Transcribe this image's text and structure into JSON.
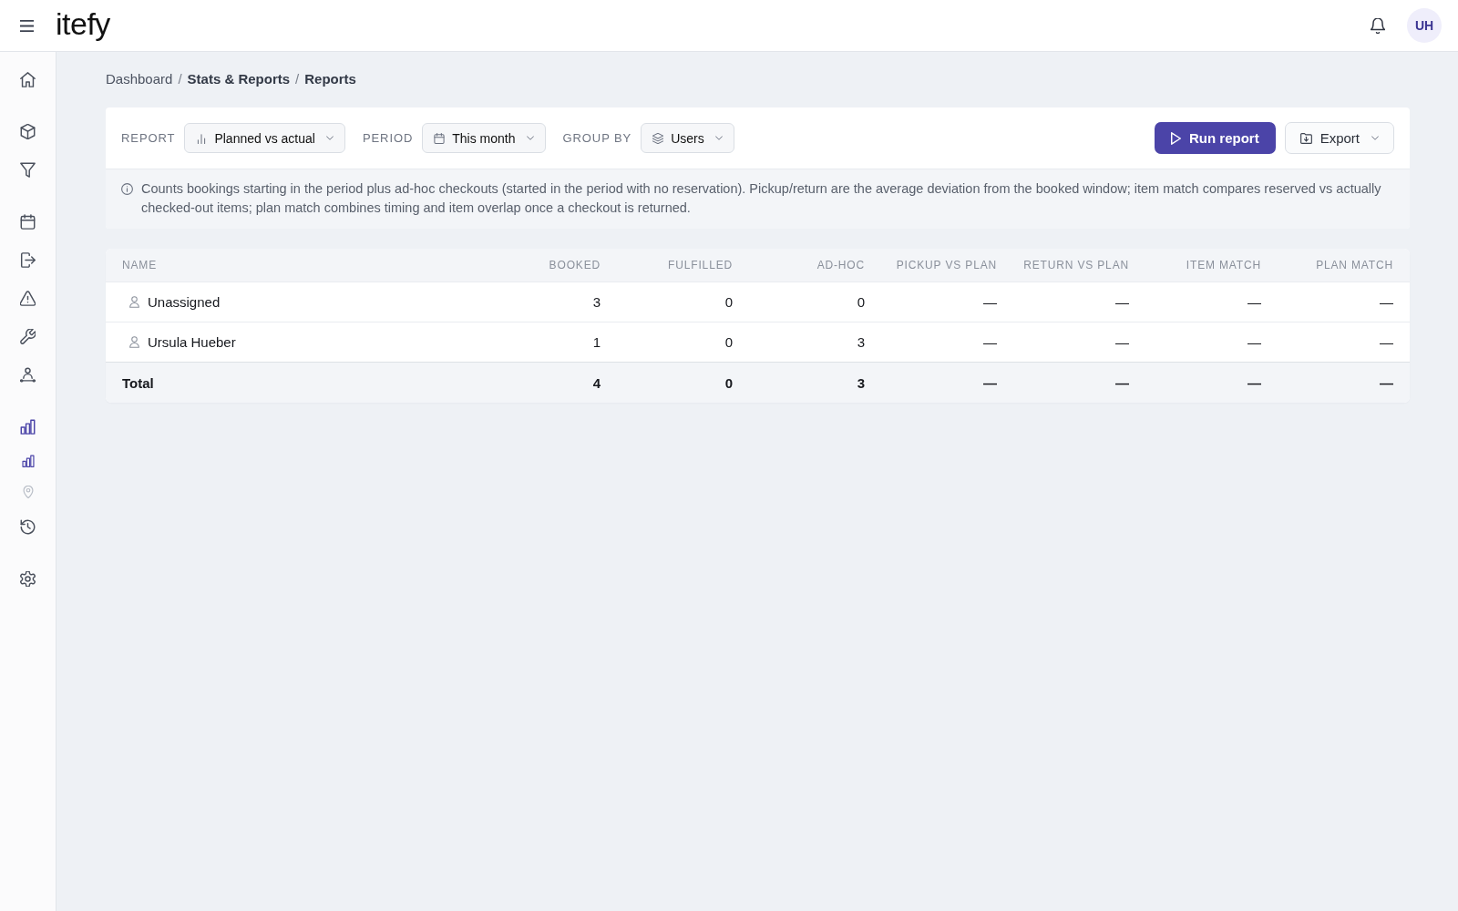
{
  "top_bar": {
    "logo": "itefy",
    "avatar_initials": "UH"
  },
  "sidebar": {
    "groups": [
      {
        "items": [
          {
            "kind": "main",
            "selected": false,
            "disabled": false
          }
        ]
      },
      {
        "items": [
          {
            "kind": "main",
            "selected": false,
            "disabled": false
          },
          {
            "kind": "main",
            "selected": false,
            "disabled": false
          }
        ]
      },
      {
        "items": [
          {
            "kind": "main",
            "selected": false,
            "disabled": false
          },
          {
            "kind": "main",
            "selected": false,
            "disabled": false
          },
          {
            "kind": "main",
            "selected": false,
            "disabled": false
          },
          {
            "kind": "main",
            "selected": false,
            "disabled": false
          },
          {
            "kind": "main",
            "selected": false,
            "disabled": false
          }
        ]
      },
      {
        "items": [
          {
            "kind": "main",
            "selected": true,
            "disabled": false
          },
          {
            "kind": "sub",
            "selected": true,
            "disabled": false
          },
          {
            "kind": "sub",
            "selected": false,
            "disabled": true
          },
          {
            "kind": "main",
            "selected": false,
            "disabled": false
          }
        ]
      },
      {
        "items": [
          {
            "kind": "main",
            "selected": false,
            "disabled": false
          }
        ]
      }
    ]
  },
  "breadcrumb": [
    {
      "kind": "link",
      "text": "Dashboard"
    },
    {
      "kind": "separator",
      "text": "/"
    },
    {
      "kind": "section",
      "text": "Stats & Reports"
    },
    {
      "kind": "separator",
      "text": "/"
    },
    {
      "kind": "current",
      "text": "Reports"
    }
  ],
  "toolbar": {
    "filters": [
      {
        "label": "REPORT",
        "value": "Planned vs actual"
      },
      {
        "label": "PERIOD",
        "value": "This month"
      },
      {
        "label": "GROUP BY",
        "value": "Users"
      }
    ],
    "run_button": "Run report",
    "export_button": "Export"
  },
  "info": "Counts bookings starting in the period plus ad-hoc checkouts (started in the period with no reservation). Pickup/return are the average deviation from the booked window; item match compares reserved vs actually checked-out items; plan match combines timing and item overlap once a checkout is returned.",
  "table": {
    "columns": [
      "NAME",
      "BOOKED",
      "FULFILLED",
      "AD-HOC",
      "PICKUP VS PLAN",
      "RETURN VS PLAN",
      "ITEM MATCH",
      "PLAN MATCH"
    ],
    "rows": [
      {
        "cells": [
          "Unassigned",
          "3",
          "0",
          "0",
          "—",
          "—",
          "—",
          "—"
        ]
      },
      {
        "cells": [
          "Ursula Hueber",
          "1",
          "0",
          "3",
          "—",
          "—",
          "—",
          "—"
        ]
      }
    ],
    "total": {
      "cells": [
        "Total",
        "4",
        "0",
        "3",
        "—",
        "—",
        "—",
        "—"
      ]
    }
  }
}
